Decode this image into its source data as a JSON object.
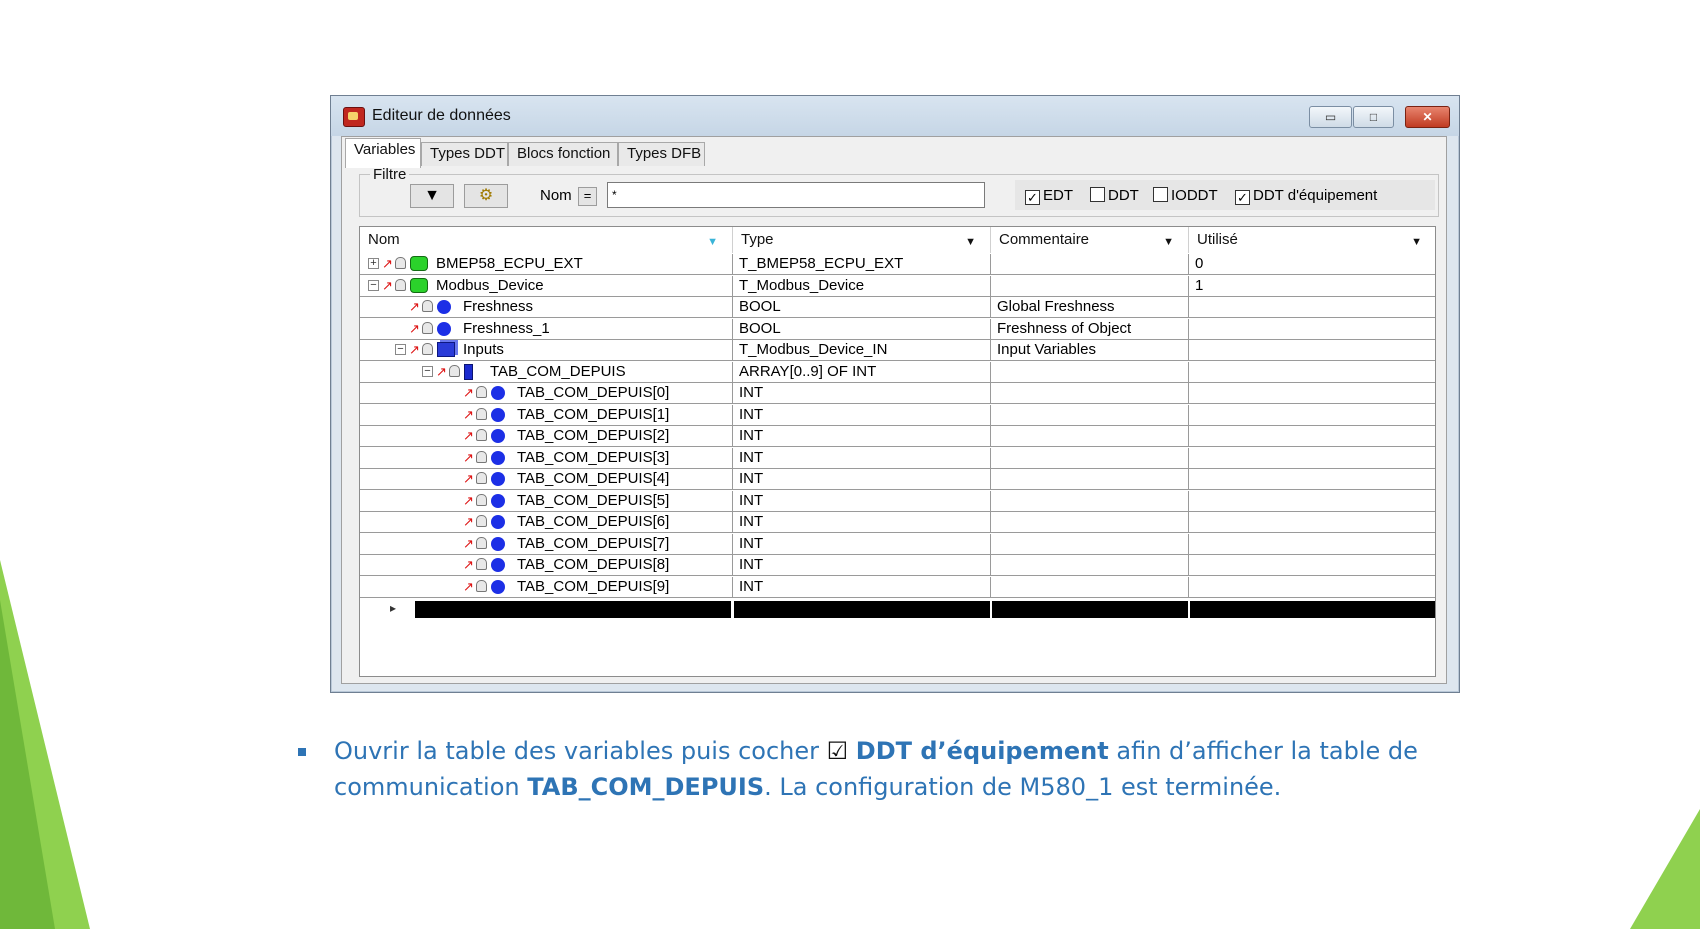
{
  "window": {
    "title": "Editeur de données",
    "controls": {
      "minimize": "▭",
      "maximize": "□",
      "close": "✕"
    }
  },
  "tabs": [
    {
      "label": "Variables",
      "active": true
    },
    {
      "label": "Types DDT",
      "active": false
    },
    {
      "label": "Blocs fonction",
      "active": false
    },
    {
      "label": "Types DFB",
      "active": false
    }
  ],
  "filter": {
    "legend": "Filtre",
    "name_label": "Nom",
    "eq_button": "=",
    "name_value": "*",
    "checkboxes": [
      {
        "label": "EDT",
        "checked": true
      },
      {
        "label": "DDT",
        "checked": false
      },
      {
        "label": "IODDT",
        "checked": false
      },
      {
        "label": "DDT d'équipement",
        "checked": true
      }
    ]
  },
  "grid": {
    "columns": [
      "Nom",
      "Type",
      "Commentaire",
      "Utilisé"
    ],
    "rows": [
      {
        "name": "BMEP58_ECPU_EXT",
        "type": "T_BMEP58_ECPU_EXT",
        "comment": "",
        "used": "0",
        "icon": "device-icon",
        "expander": "+"
      },
      {
        "name": "Modbus_Device",
        "type": "T_Modbus_Device",
        "comment": "",
        "used": "1",
        "icon": "device-icon",
        "expander": "−"
      },
      {
        "name": "Freshness",
        "type": "BOOL",
        "comment": "Global Freshness",
        "used": "",
        "icon": "variable-icon",
        "expander": ""
      },
      {
        "name": "Freshness_1",
        "type": "BOOL",
        "comment": "Freshness of Object",
        "used": "",
        "icon": "variable-icon",
        "expander": ""
      },
      {
        "name": "Inputs",
        "type": "T_Modbus_Device_IN",
        "comment": "Input Variables",
        "used": "",
        "icon": "structure-icon",
        "expander": "−"
      },
      {
        "name": "TAB_COM_DEPUIS",
        "type": "ARRAY[0..9] OF INT",
        "comment": "",
        "used": "",
        "icon": "array-icon",
        "expander": "−"
      },
      {
        "name": "TAB_COM_DEPUIS[0]",
        "type": "INT",
        "comment": "",
        "used": "",
        "icon": "variable-icon",
        "expander": ""
      },
      {
        "name": "TAB_COM_DEPUIS[1]",
        "type": "INT",
        "comment": "",
        "used": "",
        "icon": "variable-icon",
        "expander": ""
      },
      {
        "name": "TAB_COM_DEPUIS[2]",
        "type": "INT",
        "comment": "",
        "used": "",
        "icon": "variable-icon",
        "expander": ""
      },
      {
        "name": "TAB_COM_DEPUIS[3]",
        "type": "INT",
        "comment": "",
        "used": "",
        "icon": "variable-icon",
        "expander": ""
      },
      {
        "name": "TAB_COM_DEPUIS[4]",
        "type": "INT",
        "comment": "",
        "used": "",
        "icon": "variable-icon",
        "expander": ""
      },
      {
        "name": "TAB_COM_DEPUIS[5]",
        "type": "INT",
        "comment": "",
        "used": "",
        "icon": "variable-icon",
        "expander": ""
      },
      {
        "name": "TAB_COM_DEPUIS[6]",
        "type": "INT",
        "comment": "",
        "used": "",
        "icon": "variable-icon",
        "expander": ""
      },
      {
        "name": "TAB_COM_DEPUIS[7]",
        "type": "INT",
        "comment": "",
        "used": "",
        "icon": "variable-icon",
        "expander": ""
      },
      {
        "name": "TAB_COM_DEPUIS[8]",
        "type": "INT",
        "comment": "",
        "used": "",
        "icon": "variable-icon",
        "expander": ""
      },
      {
        "name": "TAB_COM_DEPUIS[9]",
        "type": "INT",
        "comment": "",
        "used": "",
        "icon": "variable-icon",
        "expander": ""
      }
    ]
  },
  "caption": {
    "part1": "Ouvrir la table des variables puis cocher ",
    "check_glyph": "☑",
    "bold1": "DDT d’équipement",
    "part2": " afin d’afficher la table de communication ",
    "bold2": "TAB_COM_DEPUIS",
    "part3": ". La configuration de M580_1 est terminée."
  },
  "colors": {
    "accent_green": "#8fd14f",
    "caption_blue": "#2e74b5"
  }
}
